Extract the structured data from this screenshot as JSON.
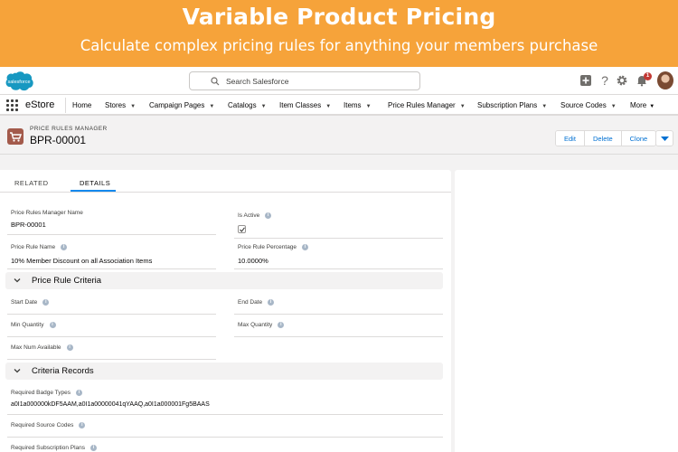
{
  "banner": {
    "title": "Variable Product Pricing",
    "subtitle": "Calculate complex pricing rules for anything your members purchase"
  },
  "header": {
    "logo_text": "salesforce",
    "search_placeholder": "Search Salesforce",
    "notification_count": "1"
  },
  "nav": {
    "app_name": "eStore",
    "items": [
      {
        "label": "Home"
      },
      {
        "label": "Stores"
      },
      {
        "label": "Campaign Pages"
      },
      {
        "label": "Catalogs"
      },
      {
        "label": "Item Classes"
      },
      {
        "label": "Items"
      },
      {
        "label": "Price Rules Manager"
      },
      {
        "label": "Subscription Plans"
      },
      {
        "label": "Source Codes"
      },
      {
        "label": "More"
      }
    ]
  },
  "record": {
    "object_label": "PRICE RULES MANAGER",
    "title": "BPR-00001",
    "actions": {
      "edit": "Edit",
      "delete": "Delete",
      "clone": "Clone"
    }
  },
  "tabs": {
    "related": "RELATED",
    "details": "DETAILS"
  },
  "fields": {
    "name_label": "Price Rules Manager Name",
    "name_value": "BPR-00001",
    "active_label": "Is Active",
    "active_checked": true,
    "rule_name_label": "Price Rule Name",
    "rule_name_value": "10% Member Discount on all Association Items",
    "percentage_label": "Price Rule Percentage",
    "percentage_value": "10.0000%"
  },
  "criteria": {
    "title": "Price Rule Criteria",
    "start_date_label": "Start Date",
    "end_date_label": "End Date",
    "min_qty_label": "Min Quantity",
    "max_qty_label": "Max Quantity",
    "max_avail_label": "Max Num Available"
  },
  "records": {
    "title": "Criteria Records",
    "badge_types_label": "Required Badge Types",
    "badge_types_value": "a0I1a000000kDF5AAM,a0I1a00000041qYAAQ,a0I1a000001Fg5BAAS",
    "source_codes_label": "Required Source Codes",
    "subscription_plans_label": "Required Subscription Plans"
  },
  "colors": {
    "banner": "#f6a33a",
    "accent": "#0070d2",
    "tab_underline": "#1589ee",
    "object_icon": "#a35a4b"
  }
}
